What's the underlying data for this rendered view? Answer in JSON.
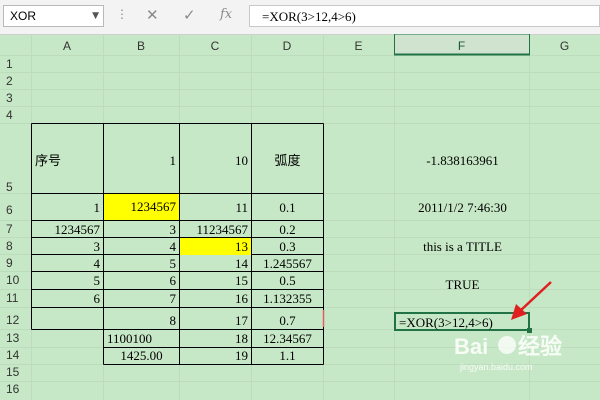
{
  "toolbar": {
    "name_box": "XOR",
    "formula": "=XOR(3>12,4>6)",
    "cancel_icon": "cancel-icon",
    "confirm_icon": "confirm-icon",
    "function_icon": "fx-icon"
  },
  "columns": [
    "A",
    "B",
    "C",
    "D",
    "E",
    "F",
    "G"
  ],
  "rows": [
    "1",
    "2",
    "3",
    "4",
    "5",
    "6",
    "7",
    "8",
    "9",
    "10",
    "11",
    "12",
    "13",
    "14",
    "15",
    "16"
  ],
  "header": {
    "a5": "序号",
    "b5": "1",
    "c5": "10",
    "d5": "弧度"
  },
  "table": [
    [
      "1",
      "1234567",
      "11",
      "0.1"
    ],
    [
      "1234567",
      "3",
      "11234567",
      "0.2"
    ],
    [
      "3",
      "4",
      "13",
      "0.3"
    ],
    [
      "4",
      "5",
      "14",
      "1.245567"
    ],
    [
      "5",
      "6",
      "15",
      "0.5"
    ],
    [
      "6",
      "7",
      "16",
      "1.132355"
    ],
    [
      "",
      "8",
      "17",
      "0.7"
    ],
    [
      "",
      "1100100",
      "18",
      "12.34567"
    ],
    [
      "",
      "1425.00",
      "19",
      "1.1"
    ]
  ],
  "col_f": {
    "f5": "-1.838163961",
    "f6": "2011/1/2 7:46:30",
    "f8": "this is a TITLE",
    "f10": "TRUE",
    "f12": "=XOR(3>12,4>6)"
  },
  "colors": {
    "sheet_bg": "#c7e8c7",
    "highlight": "#ffff00",
    "active_border": "#217346",
    "arrow": "#e02020"
  }
}
